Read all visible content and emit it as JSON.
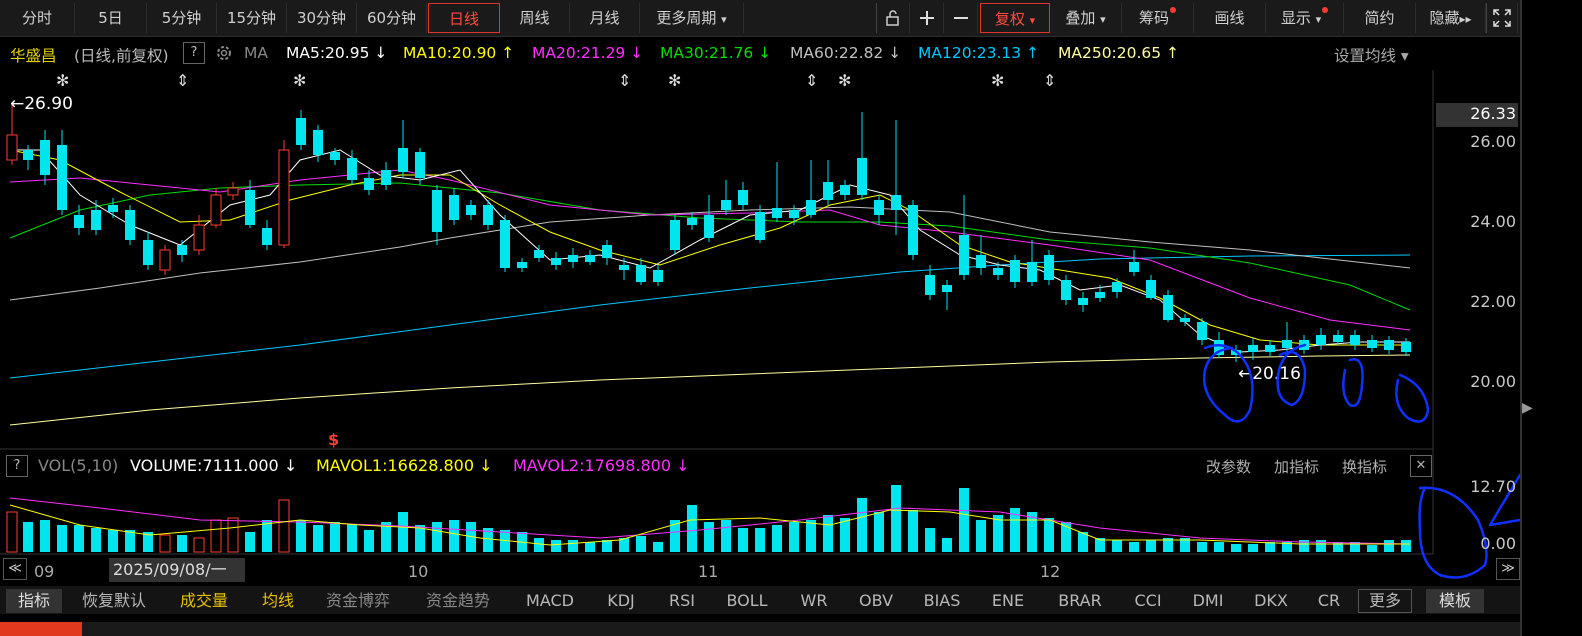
{
  "colors": {
    "up": "#ff3b30",
    "down": "#00e5ee",
    "ma5": "#ffffff",
    "ma10": "#ffff00",
    "ma20": "#ff2dff",
    "ma30": "#00dd00",
    "ma60": "#c0c0c0",
    "ma120": "#00c8ff",
    "ma250": "#ffffa0",
    "annotation": "#1030ff"
  },
  "toolbar": {
    "periods": [
      "分时",
      "5日",
      "5分钟",
      "15分钟",
      "30分钟",
      "60分钟",
      "日线",
      "周线",
      "月线",
      "更多周期"
    ],
    "active_period": "日线",
    "more_arrow": "▾",
    "icons": [
      "lock-icon",
      "zoom-in-icon",
      "zoom-out-icon"
    ],
    "right_buttons": [
      "复权",
      "叠加",
      "筹码",
      "画线",
      "显示",
      "简约",
      "隐藏"
    ],
    "hide_arrow": "▸▸"
  },
  "ma_legend": {
    "stock": "华盛昌",
    "mode": "(日线,前复权)",
    "help": "?",
    "ma_label": "MA",
    "items": [
      {
        "text": "MA5:20.95",
        "dir": "↓",
        "color": "#ffffff"
      },
      {
        "text": "MA10:20.90",
        "dir": "↑",
        "color": "#ffff00"
      },
      {
        "text": "MA20:21.29",
        "dir": "↓",
        "color": "#ff2dff"
      },
      {
        "text": "MA30:21.76",
        "dir": "↓",
        "color": "#00dd00"
      },
      {
        "text": "MA60:22.82",
        "dir": "↓",
        "color": "#c0c0c0"
      },
      {
        "text": "MA120:23.13",
        "dir": "↑",
        "color": "#00c8ff"
      },
      {
        "text": "MA250:20.65",
        "dir": "↑",
        "color": "#ffffa0"
      }
    ],
    "settings": "设置均线 ▾"
  },
  "price_axis": {
    "current": "26.33",
    "ticks": [
      "26.00",
      "24.00",
      "22.00",
      "20.00"
    ]
  },
  "annotations": {
    "high": "←26.90",
    "low": "←20.16",
    "signal": "$"
  },
  "volume_legend": {
    "help": "?",
    "name": "VOL(5,10)",
    "items": [
      {
        "text": "VOLUME:7111.000",
        "dir": "↓",
        "color": "#ffffff"
      },
      {
        "text": "MAVOL1:16628.800",
        "dir": "↓",
        "color": "#ffff00"
      },
      {
        "text": "MAVOL2:17698.800",
        "dir": "↓",
        "color": "#ff2dff"
      }
    ],
    "actions": [
      "改参数",
      "加指标",
      "换指标"
    ],
    "close": "✕"
  },
  "volume_axis": {
    "top": "12.70",
    "bottom": "0.00"
  },
  "time_axis": {
    "scroll_left": "≪",
    "scroll_right": "≫",
    "labels": [
      "09",
      "2025/09/08/一",
      "10",
      "11",
      "12"
    ]
  },
  "indicator_bar": {
    "items": [
      "指标",
      "恢复默认",
      "成交量",
      "均线",
      "资金博弈",
      "资金趋势",
      "MACD",
      "KDJ",
      "RSI",
      "BOLL",
      "WR",
      "OBV",
      "BIAS",
      "ENE",
      "BRAR",
      "CCI",
      "DMI",
      "DKX",
      "CR",
      "更多",
      "模板"
    ],
    "highlight": [
      "成交量",
      "均线"
    ]
  }
}
